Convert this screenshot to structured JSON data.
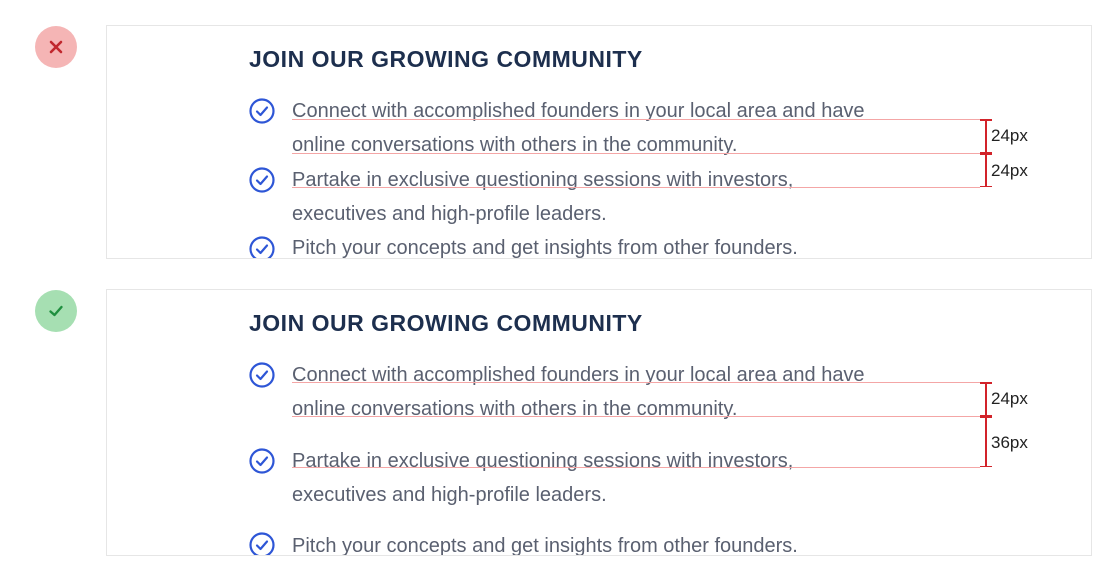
{
  "colors": {
    "heading": "#1d2f4e",
    "body_text": "#5a6070",
    "check_icon": "#2e56d6",
    "guide_line": "#f4a6a6",
    "measure_marker": "#d2232a",
    "bad_badge": "#f5b5b5",
    "bad_icon": "#c1272d",
    "good_badge": "#a6dfb2",
    "good_icon": "#1f8f3f"
  },
  "incorrect_example": {
    "badge_icon": "close-icon",
    "heading": "JOIN OUR GROWING COMMUNITY",
    "items": [
      {
        "icon": "check-circle-icon",
        "lines": [
          "Connect with accomplished founders in your local area and have",
          "online conversations with others in the community."
        ]
      },
      {
        "icon": "check-circle-icon",
        "lines": [
          "Partake in exclusive questioning sessions with investors,",
          "executives and high-profile leaders."
        ]
      },
      {
        "icon": "check-circle-icon",
        "lines": [
          "Pitch your concepts and get insights from other founders."
        ]
      }
    ],
    "line_spacing_label": "24px",
    "item_spacing_label": "24px"
  },
  "correct_example": {
    "badge_icon": "check-icon",
    "heading": "JOIN OUR GROWING COMMUNITY",
    "items": [
      {
        "icon": "check-circle-icon",
        "lines": [
          "Connect with accomplished founders in your local area and have",
          "online conversations with others in the community."
        ]
      },
      {
        "icon": "check-circle-icon",
        "lines": [
          "Partake in exclusive questioning sessions with investors,",
          "executives and high-profile leaders."
        ]
      },
      {
        "icon": "check-circle-icon",
        "lines": [
          "Pitch your concepts and get insights from other founders."
        ]
      }
    ],
    "line_spacing_label": "24px",
    "item_spacing_label": "36px"
  }
}
